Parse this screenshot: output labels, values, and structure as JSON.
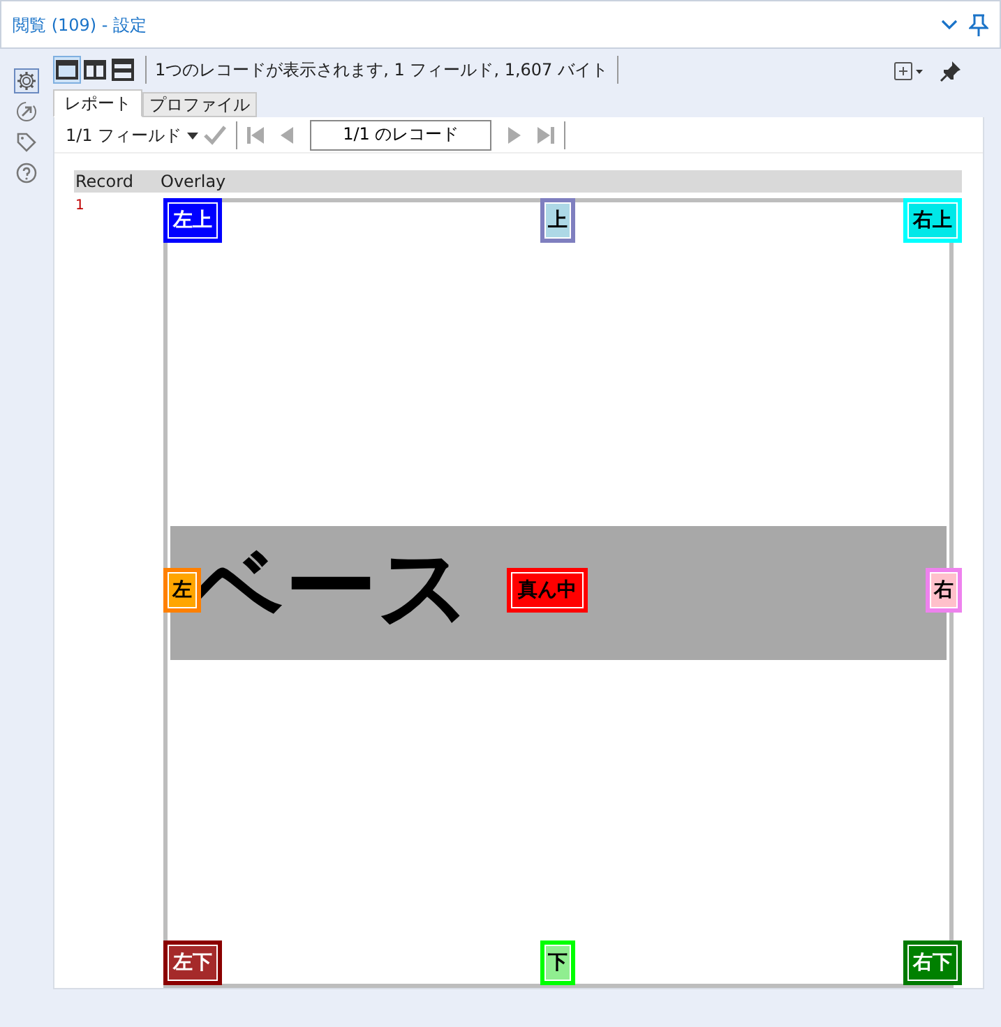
{
  "window": {
    "title": "閲覧 (109) - 設定"
  },
  "side_tabs": [
    {
      "selected": true
    },
    {
      "selected": false
    },
    {
      "selected": false
    },
    {
      "selected": false
    }
  ],
  "view_modes": [
    {
      "selected": true
    },
    {
      "selected": false
    },
    {
      "selected": false
    }
  ],
  "status": "1つのレコードが表示されます, 1 フィールド, 1,607 バイト",
  "tabs": [
    {
      "label": "レポート",
      "selected": true
    },
    {
      "label": "プロファイル",
      "selected": false
    }
  ],
  "nav": {
    "field_selector": "1/1 フィールド",
    "record": "1/1 のレコード"
  },
  "table": {
    "columns": [
      "Record",
      "Overlay"
    ],
    "rows": [
      {
        "record": "1",
        "overlay": {
          "base_text": "ベース",
          "labels": [
            {
              "text": "左上",
              "color": "#0000ff",
              "border": {
                "color": "#0000ff"
              },
              "kind": "light"
            },
            {
              "text": "上",
              "color": "#add8e6",
              "border": {
                "color": "#7f7fbf"
              },
              "kind": "dark"
            },
            {
              "text": "右上",
              "color": "#00e8e8",
              "border": {
                "color": "#00ffff"
              },
              "kind": "dark"
            },
            {
              "text": "左",
              "color": "#ffa500",
              "border": {
                "color": "#ff8000"
              },
              "kind": "dark"
            },
            {
              "text": "真ん中",
              "color": "#ff0000",
              "border": {
                "color": "#ff0000"
              },
              "kind": "dark"
            },
            {
              "text": "右",
              "color": "#ffc0cb",
              "border": {
                "color": "#ee82ee"
              },
              "kind": "dark"
            },
            {
              "text": "左下",
              "color": "#a52a2a",
              "border": {
                "color": "#8b0000"
              },
              "kind": "light"
            },
            {
              "text": "下",
              "color": "#90ee90",
              "border": {
                "color": "#00ff00"
              },
              "kind": "dark"
            },
            {
              "text": "右下",
              "color": "#008000",
              "border": {
                "color": "#007a00"
              },
              "kind": "light"
            }
          ]
        }
      }
    ]
  }
}
